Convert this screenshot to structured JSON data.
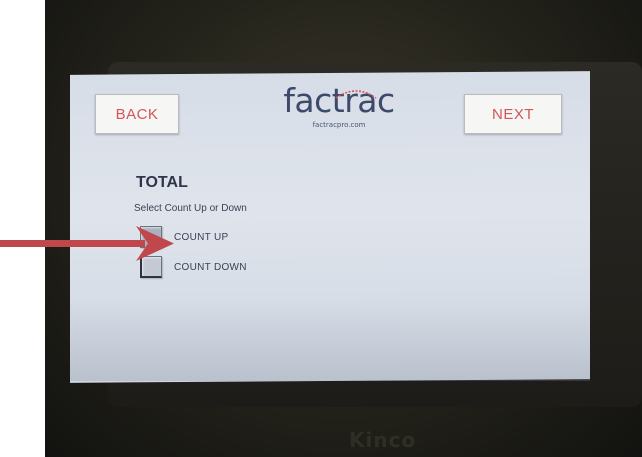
{
  "header": {
    "back_label": "BACK",
    "next_label": "NEXT",
    "logo_text": "factrac",
    "logo_url": "factracpro.com"
  },
  "main": {
    "title": "TOTAL",
    "subtitle": "Select Count Up or Down",
    "options": [
      {
        "label": "COUNT UP",
        "selected": true
      },
      {
        "label": "COUNT DOWN",
        "selected": false
      }
    ]
  },
  "device": {
    "brand": "Kinco"
  },
  "colors": {
    "button_text": "#d3555a",
    "logo": "#3d4a6b",
    "arrow": "#c0484c",
    "screen": "#dfe4ec"
  },
  "icons": {
    "annotation": "right-arrow-icon"
  }
}
